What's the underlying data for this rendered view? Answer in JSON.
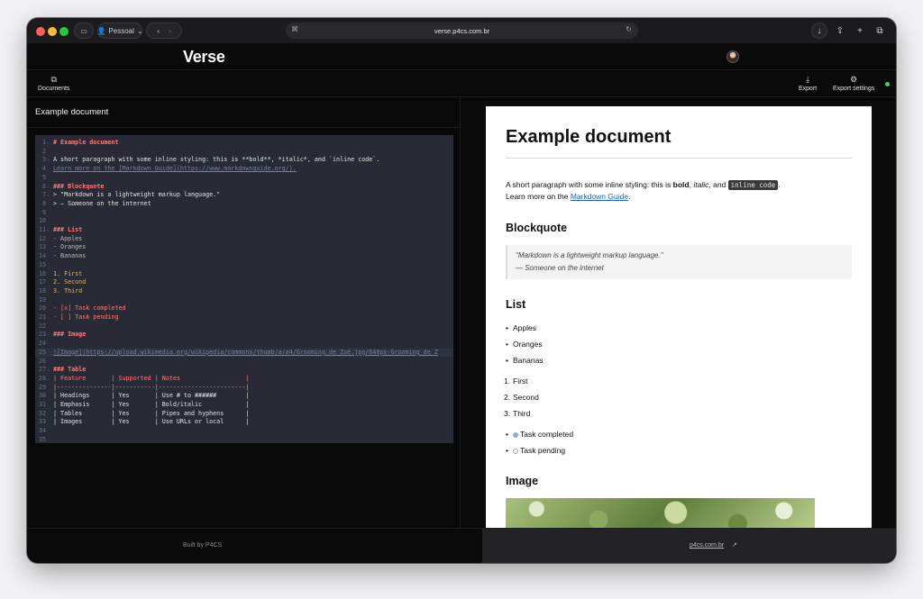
{
  "browser": {
    "profile_label": "Pessoal",
    "url": "verse.p4cs.com.br"
  },
  "app": {
    "brand": "Verse",
    "toolbar": {
      "documents_label": "Documents",
      "export_label": "Export",
      "export_settings_label": "Export settings"
    },
    "accent_colors": {
      "status_dot": "#3ed07a"
    }
  },
  "editor": {
    "document_title": "Example document",
    "lines": [
      {
        "n": "1",
        "fold": true,
        "text": "# Example document",
        "kind": "head"
      },
      {
        "n": "2",
        "fold": false,
        "text": "",
        "kind": "plain"
      },
      {
        "n": "3",
        "fold": true,
        "text": "A short paragraph with some inline styling: this is **bold**, *italic*, and `inline code`.",
        "kind": "plain"
      },
      {
        "n": "4",
        "fold": false,
        "text": "Learn more on the [Markdown Guide](https://www.markdownguide.org/).",
        "kind": "link"
      },
      {
        "n": "5",
        "fold": false,
        "text": "",
        "kind": "plain"
      },
      {
        "n": "6",
        "fold": true,
        "text": "### Blockquote",
        "kind": "head"
      },
      {
        "n": "7",
        "fold": true,
        "text": "> \"Markdown is a lightweight markup language.\"",
        "kind": "plain"
      },
      {
        "n": "8",
        "fold": false,
        "text": "> — Someone on the internet",
        "kind": "plain"
      },
      {
        "n": "9",
        "fold": false,
        "text": "",
        "kind": "plain"
      },
      {
        "n": "10",
        "fold": false,
        "text": "",
        "kind": "plain"
      },
      {
        "n": "11",
        "fold": true,
        "text": "### List",
        "kind": "head"
      },
      {
        "n": "12",
        "fold": false,
        "text": "- Apples",
        "kind": "list"
      },
      {
        "n": "13",
        "fold": false,
        "text": "- Oranges",
        "kind": "list"
      },
      {
        "n": "14",
        "fold": false,
        "text": "- Bananas",
        "kind": "list"
      },
      {
        "n": "15",
        "fold": false,
        "text": "",
        "kind": "plain"
      },
      {
        "n": "16",
        "fold": false,
        "text": "1. First",
        "kind": "num"
      },
      {
        "n": "17",
        "fold": false,
        "text": "2. Second",
        "kind": "num"
      },
      {
        "n": "18",
        "fold": false,
        "text": "3. Third",
        "kind": "num"
      },
      {
        "n": "19",
        "fold": false,
        "text": "",
        "kind": "plain"
      },
      {
        "n": "20",
        "fold": false,
        "text": "- [x] Task completed",
        "kind": "task"
      },
      {
        "n": "21",
        "fold": false,
        "text": "- [ ] Task pending",
        "kind": "task"
      },
      {
        "n": "22",
        "fold": false,
        "text": "",
        "kind": "plain"
      },
      {
        "n": "23",
        "fold": true,
        "text": "### Image",
        "kind": "head"
      },
      {
        "n": "24",
        "fold": false,
        "text": "",
        "kind": "plain"
      },
      {
        "n": "25",
        "fold": false,
        "text": "![Image](https://upload.wikimedia.org/wikipedia/commons/thumb/a/a4/Grooming_de_Zoé.jpg/640px-Grooming_de_Z",
        "kind": "link"
      },
      {
        "n": "26",
        "fold": false,
        "text": "",
        "kind": "plain"
      },
      {
        "n": "27",
        "fold": true,
        "text": "### Table",
        "kind": "head"
      },
      {
        "n": "28",
        "fold": true,
        "text": "| Feature       | Supported | Notes                  |",
        "kind": "tablehead"
      },
      {
        "n": "29",
        "fold": false,
        "text": "|---------------|-----------|------------------------|",
        "kind": "table"
      },
      {
        "n": "30",
        "fold": false,
        "text": "| Headings      | Yes       | Use # to ######        |",
        "kind": "plain"
      },
      {
        "n": "31",
        "fold": false,
        "text": "| Emphasis      | Yes       | Bold/italic            |",
        "kind": "plain"
      },
      {
        "n": "32",
        "fold": false,
        "text": "| Tables        | Yes       | Pipes and hyphens      |",
        "kind": "plain"
      },
      {
        "n": "33",
        "fold": false,
        "text": "| Images        | Yes       | Use URLs or local      |",
        "kind": "plain"
      },
      {
        "n": "34",
        "fold": false,
        "text": "",
        "kind": "plain"
      },
      {
        "n": "35",
        "fold": false,
        "text": "",
        "kind": "plain"
      }
    ]
  },
  "preview": {
    "h1": "Example document",
    "para_prefix": "A short paragraph with some inline styling: this is ",
    "bold": "bold",
    "comma": ", ",
    "italic": "italic",
    "and": ", and ",
    "code": "inline code",
    "period": ".",
    "learn_prefix": "Learn more on the ",
    "link": "Markdown Guide",
    "learn_suffix": ".",
    "blockquote_heading": "Blockquote",
    "quote_line1": "\"Markdown is a lightweight markup language.\"",
    "quote_line2": "— Someone on the internet",
    "list_heading": "List",
    "bullets": [
      "Apples",
      "Oranges",
      "Bananas"
    ],
    "ordered": [
      "First",
      "Second",
      "Third"
    ],
    "tasks": [
      {
        "label": "Task completed",
        "done": true
      },
      {
        "label": "Task pending",
        "done": false
      }
    ],
    "image_heading": "Image"
  },
  "footer": {
    "built_by": "Built by P4CS",
    "site": "p4cs.com.br",
    "site_arrow": "↗"
  }
}
